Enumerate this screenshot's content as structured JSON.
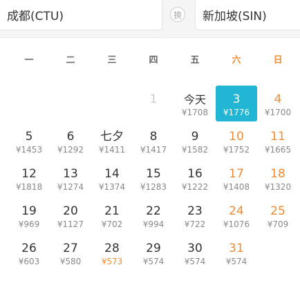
{
  "route": {
    "from": "成都(CTU)",
    "swap_label": "换",
    "to": "新加坡(SIN)"
  },
  "weekdays": [
    "一",
    "二",
    "三",
    "四",
    "五",
    "六",
    "日"
  ],
  "days": [
    {
      "day": "1",
      "price": "",
      "state": "past"
    },
    {
      "day": "今天",
      "price": "¥1708",
      "state": "today"
    },
    {
      "day": "3",
      "price": "¥1776",
      "state": "selected"
    },
    {
      "day": "4",
      "price": "¥1700"
    },
    {
      "day": "5",
      "price": "¥1453"
    },
    {
      "day": "6",
      "price": "¥1292"
    },
    {
      "day": "七夕",
      "price": "¥1411"
    },
    {
      "day": "8",
      "price": "¥1417"
    },
    {
      "day": "9",
      "price": "¥1582"
    },
    {
      "day": "10",
      "price": "¥1752"
    },
    {
      "day": "11",
      "price": "¥1665"
    },
    {
      "day": "12",
      "price": "¥1818"
    },
    {
      "day": "13",
      "price": "¥1274"
    },
    {
      "day": "14",
      "price": "¥1374"
    },
    {
      "day": "15",
      "price": "¥1283"
    },
    {
      "day": "16",
      "price": "¥1222"
    },
    {
      "day": "17",
      "price": "¥1408"
    },
    {
      "day": "18",
      "price": "¥1320"
    },
    {
      "day": "19",
      "price": "¥969"
    },
    {
      "day": "20",
      "price": "¥1127"
    },
    {
      "day": "21",
      "price": "¥702"
    },
    {
      "day": "22",
      "price": "¥994"
    },
    {
      "day": "23",
      "price": "¥722"
    },
    {
      "day": "24",
      "price": "¥1076"
    },
    {
      "day": "25",
      "price": "¥709"
    },
    {
      "day": "26",
      "price": "¥603"
    },
    {
      "day": "27",
      "price": "¥580"
    },
    {
      "day": "28",
      "price": "¥573",
      "state": "cheapest"
    },
    {
      "day": "29",
      "price": "¥574"
    },
    {
      "day": "30",
      "price": "¥574"
    },
    {
      "day": "31",
      "price": "¥574"
    }
  ],
  "colors": {
    "selected_bg": "#20b6d4",
    "weekend": "#f08c34",
    "lowest_price": "#f08c34"
  }
}
